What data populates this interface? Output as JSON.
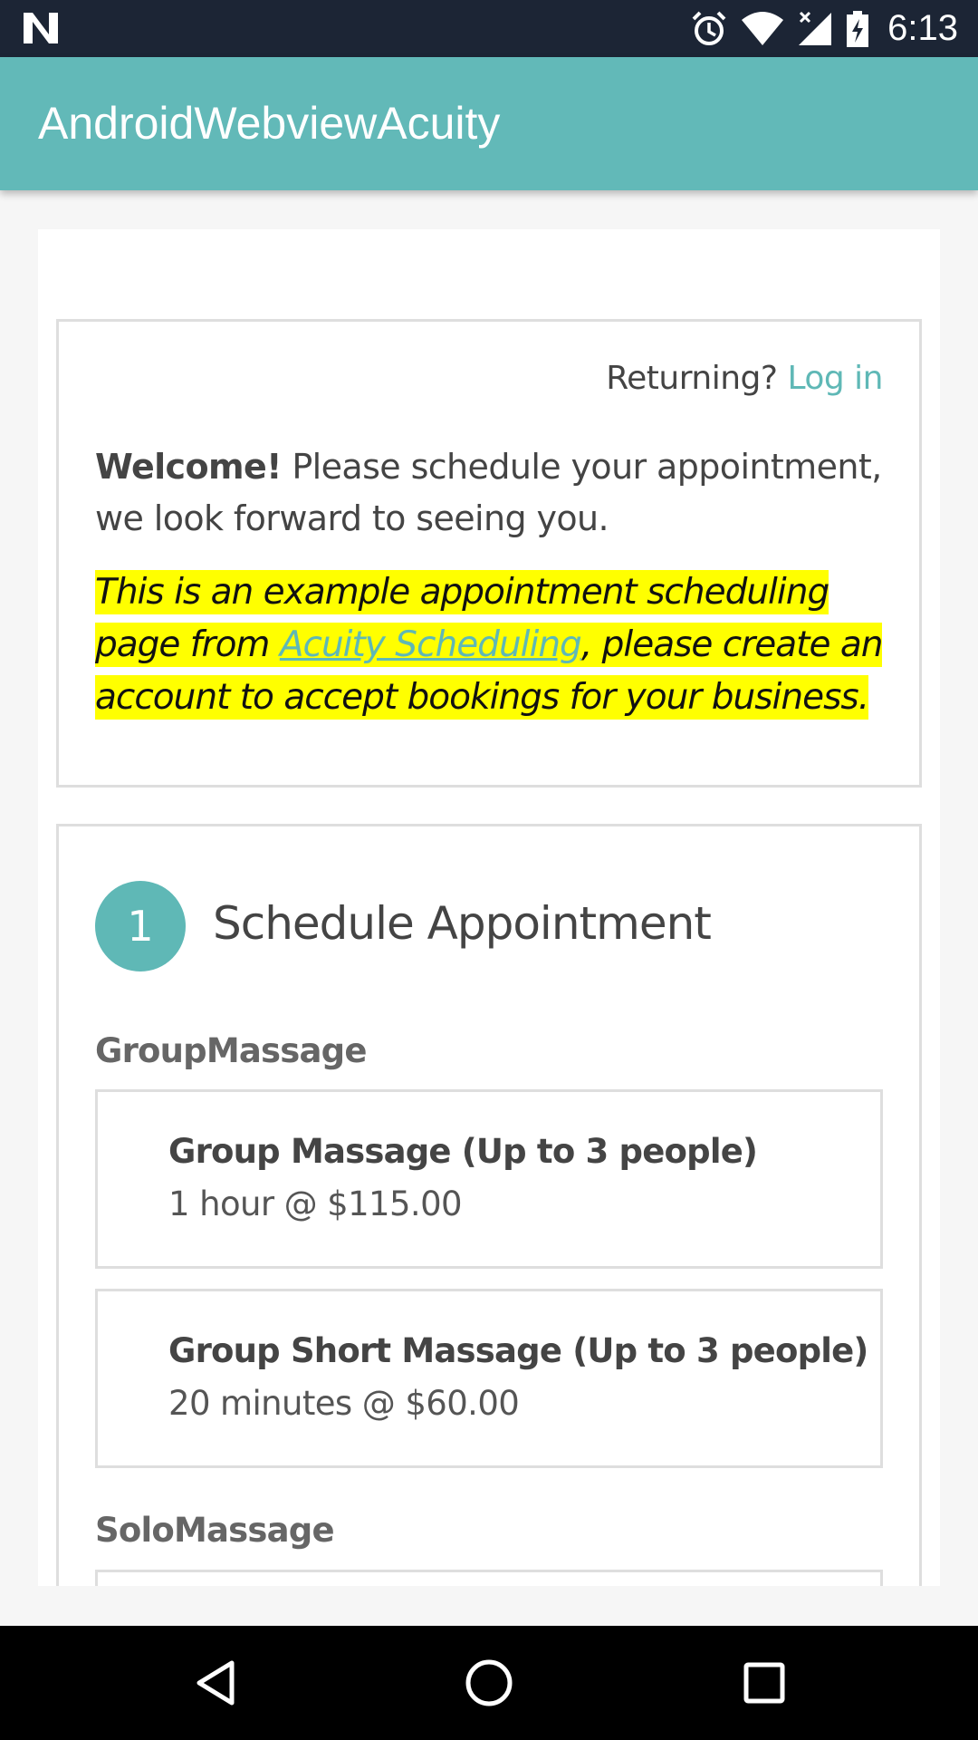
{
  "status_bar": {
    "time": "6:13",
    "icons": [
      "android-n-icon",
      "alarm-icon",
      "wifi-icon",
      "signal-icon",
      "battery-charging-icon"
    ]
  },
  "app_bar": {
    "title": "AndroidWebviewAcuity"
  },
  "welcome_card": {
    "returning_label": "Returning?",
    "login_link": "Log in",
    "welcome_bold": "Welcome!",
    "welcome_text": " Please schedule your appointment, we look forward to seeing you.",
    "example_prefix": "This is an example appointment scheduling page from ",
    "example_link": "Acuity Scheduling",
    "example_suffix": ", please create an account to accept bookings for your business.",
    "highlight_color": "#ffff00"
  },
  "schedule_card": {
    "step_number": "1",
    "step_title": "Schedule Appointment",
    "groups": [
      {
        "label": "GroupMassage",
        "services": [
          {
            "name": "Group Massage (Up to 3 people)",
            "detail": "1 hour @ $115.00"
          },
          {
            "name": "Group Short Massage (Up to 3 people)",
            "detail": "20 minutes @ $60.00"
          }
        ]
      },
      {
        "label": "SoloMassage",
        "services": []
      }
    ]
  },
  "colors": {
    "accent": "#5fb8b6",
    "app_bar": "#62b9b8",
    "status_bar": "#1c2535"
  },
  "nav_bar": {
    "icons": [
      "back-icon",
      "home-icon",
      "recents-icon"
    ]
  }
}
